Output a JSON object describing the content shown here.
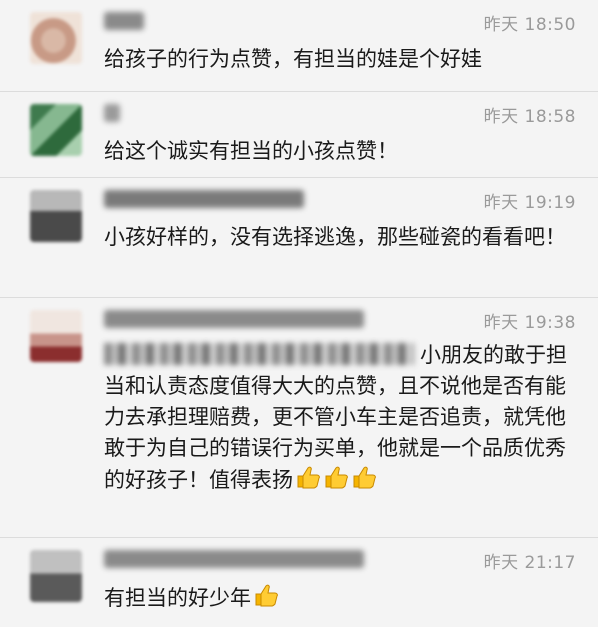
{
  "comments": [
    {
      "time": "昨天 18:50",
      "text": "给孩子的行为点赞，有担当的娃是个好娃",
      "thumbs": 0
    },
    {
      "time": "昨天 18:58",
      "text": "给这个诚实有担当的小孩点赞！",
      "thumbs": 0
    },
    {
      "time": "昨天 19:19",
      "text": "小孩好样的，没有选择逃逸，那些碰瓷的看看吧！",
      "thumbs": 0
    },
    {
      "time": "昨天 19:38",
      "text_line1": "小朋友的敢于",
      "text_rest": "担当和认责态度值得大大的点赞，且不说他是否有能力去承担理赔费，更不管小车主是否追责，就凭他敢于为自己的错误行为买单，他就是一个品质优秀的好孩子！值得表扬",
      "thumbs": 3
    },
    {
      "time": "昨天 21:17",
      "text": "有担当的好少年",
      "thumbs": 1
    }
  ],
  "colors": {
    "background": "#f4f4f4",
    "time": "#9a9a9a",
    "text": "#1a1a1a",
    "divider": "#dcdcdc"
  },
  "icons": {
    "thumb": "thumbs-up-emoji"
  }
}
